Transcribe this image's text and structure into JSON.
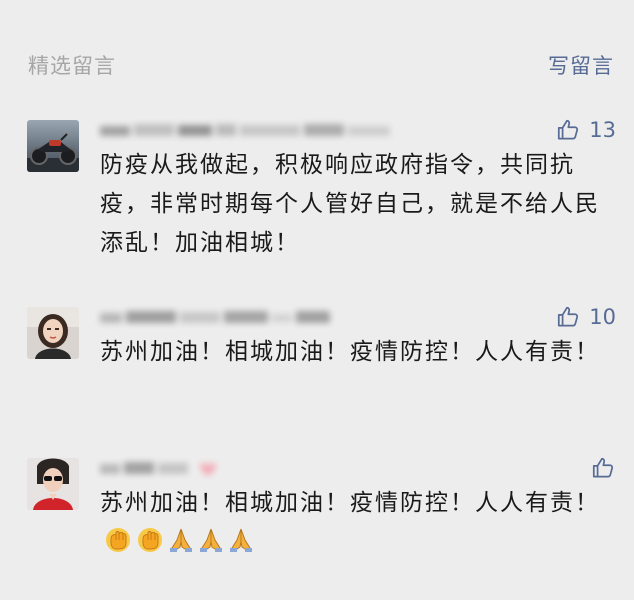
{
  "header": {
    "title": "精选留言",
    "write_label": "写留言"
  },
  "comments": [
    {
      "avatar": "motorcycle-avatar",
      "like_count": "13",
      "text": "防疫从我做起，积极响应政府指令，共同抗疫，非常时期每个人管好自己，就是不给人民添乱！加油相城！"
    },
    {
      "avatar": "woman-selfie-avatar",
      "like_count": "10",
      "text": "苏州加油！相城加油！疫情防控！人人有责！"
    },
    {
      "avatar": "woman-red-jacket-avatar",
      "like_count": "",
      "text": "苏州加油！相城加油！疫情防控！人人有责！",
      "emojis": [
        "fist-emoji",
        "fist-emoji",
        "praying-hands-emoji",
        "praying-hands-emoji",
        "praying-hands-emoji"
      ]
    }
  ],
  "colors": {
    "background": "#ededed",
    "link": "#576b95",
    "muted": "#a6a6a6",
    "text": "#1a1a1a"
  }
}
